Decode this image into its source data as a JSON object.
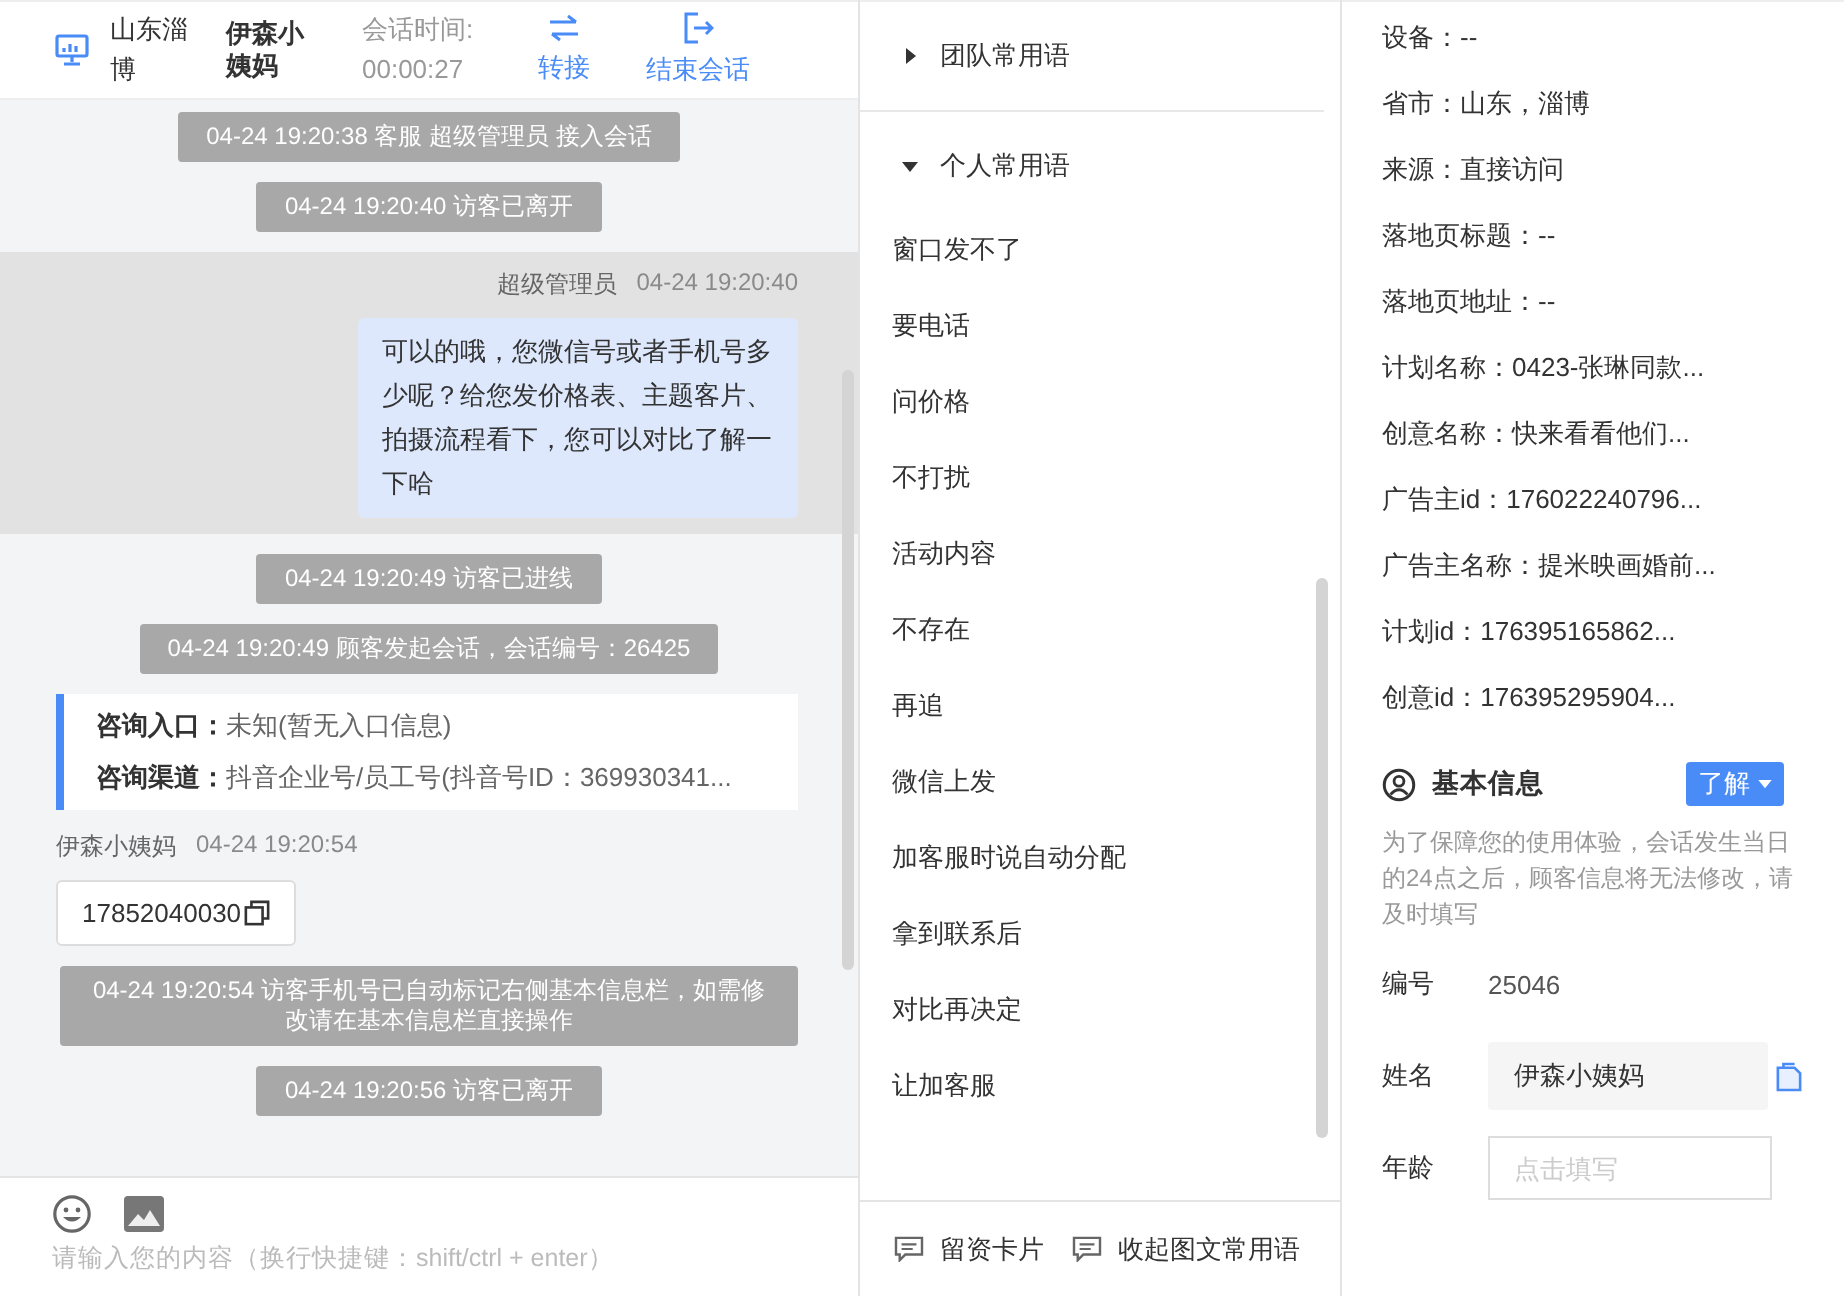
{
  "chat": {
    "header": {
      "location": "山东淄博",
      "visitor": "伊森小姨妈",
      "timer_label": "会话时间:",
      "timer": "00:00:27",
      "actions": [
        {
          "kind": "transfer",
          "label": "转接"
        },
        {
          "kind": "end",
          "label": "结束会话"
        }
      ]
    },
    "messages": [
      {
        "kind": "system",
        "text": "04-24 19:20:38 客服 超级管理员 接入会话"
      },
      {
        "kind": "system",
        "text": "04-24 19:20:40 访客已离开"
      },
      {
        "kind": "agent",
        "name": "超级管理员",
        "time": "04-24 19:20:40",
        "text": "可以的哦，您微信号或者手机号多少呢？给您发价格表、主题客片、拍摄流程看下，您可以对比了解一下哈",
        "highlighted": true
      },
      {
        "kind": "system",
        "text": "04-24 19:20:49 访客已进线"
      },
      {
        "kind": "system",
        "text": "04-24 19:20:49 顾客发起会话，会话编号：26425"
      },
      {
        "kind": "info",
        "rows": [
          {
            "label": "咨询入口：",
            "value": "未知(暂无入口信息)"
          },
          {
            "label": "咨询渠道：",
            "value": "抖音企业号/员工号(抖音号ID：369930341..."
          }
        ]
      },
      {
        "kind": "visitor",
        "name": "伊森小姨妈",
        "time": "04-24 19:20:54",
        "text": "17852040030"
      },
      {
        "kind": "system",
        "text": "04-24 19:20:54 访客手机号已自动标记右侧基本信息栏，如需修改请在基本信息栏直接操作"
      },
      {
        "kind": "system",
        "text": "04-24 19:20:56 访客已离开"
      }
    ],
    "input": {
      "placeholder": "请输入您的内容（换行快捷键：shift/ctrl + enter）"
    }
  },
  "phrases": {
    "groups": [
      {
        "label": "团队常用语",
        "expanded": false
      },
      {
        "label": "个人常用语",
        "expanded": true,
        "items": [
          "窗口发不了",
          "要电话",
          "问价格",
          "不打扰",
          "活动内容",
          "不存在",
          "再追",
          "微信上发",
          "加客服时说自动分配",
          "拿到联系后",
          "对比再决定",
          "让加客服"
        ]
      }
    ],
    "footer": [
      "留资卡片",
      "收起图文常用语"
    ]
  },
  "details": {
    "lines": [
      "设备：--",
      "省市：山东，淄博",
      "来源：直接访问",
      "落地页标题：--",
      "落地页地址：--",
      "计划名称：0423-张琳同款...",
      "创意名称：快来看看他们...",
      "广告主id：176022240796...",
      "广告主名称：提米映画婚前...",
      "计划id：176395165862...",
      "创意id：176395295904..."
    ],
    "basic": {
      "title": "基本信息",
      "button": "了解",
      "note": "为了保障您的使用体验，会话发生当日的24点之后，顾客信息将无法修改，请及时填写",
      "fields": [
        {
          "kind": "text",
          "label": "编号",
          "value": "25046"
        },
        {
          "kind": "readonly",
          "label": "姓名",
          "value": "伊森小姨妈"
        },
        {
          "kind": "input",
          "label": "年龄",
          "placeholder": "点击填写"
        }
      ]
    }
  }
}
